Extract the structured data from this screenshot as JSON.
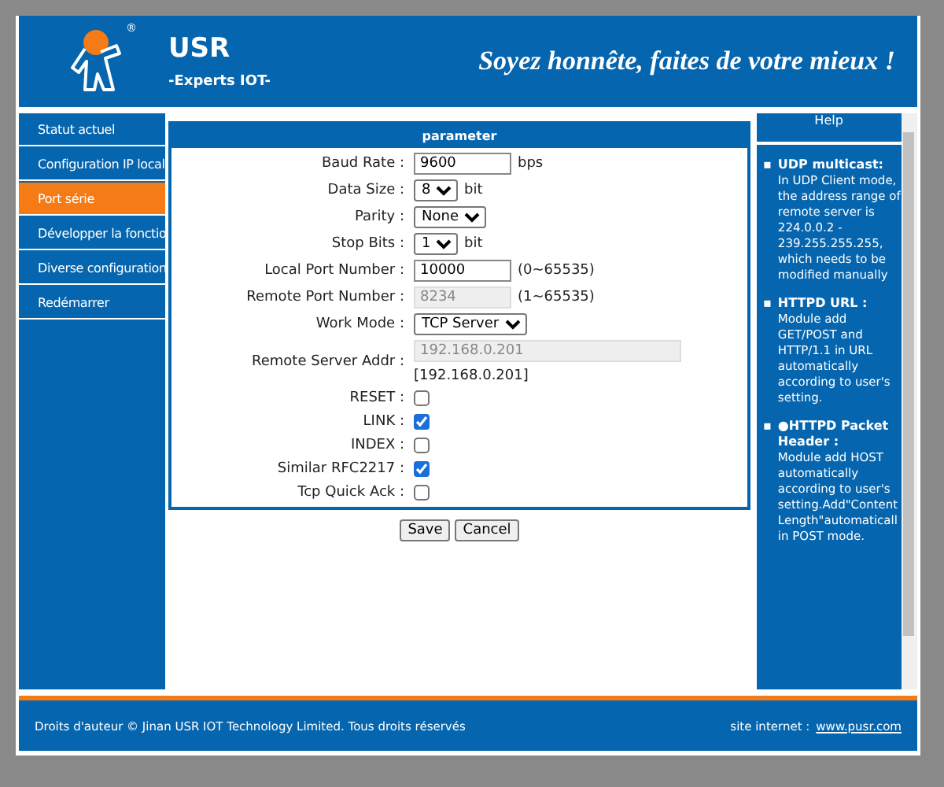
{
  "header": {
    "brand": "USR",
    "registered": "®",
    "tagline": "-Experts IOT-",
    "motto": "Soyez honnête, faites de votre mieux !"
  },
  "sidebar": {
    "items": [
      {
        "label": "Statut actuel",
        "selected": false
      },
      {
        "label": "Configuration IP local",
        "selected": false
      },
      {
        "label": "Port série",
        "selected": true
      },
      {
        "label": "Développer la fonctio",
        "selected": false
      },
      {
        "label": "Diverse configuration",
        "selected": false
      },
      {
        "label": "Redémarrer",
        "selected": false
      }
    ]
  },
  "panel": {
    "title": "parameter",
    "fields": [
      {
        "kind": "input",
        "label": "Baud Rate :",
        "value": "9600",
        "suffix": "bps",
        "disabled": false
      },
      {
        "kind": "select",
        "label": "Data Size :",
        "value": "8",
        "suffix": "bit"
      },
      {
        "kind": "select",
        "label": "Parity :",
        "value": "None"
      },
      {
        "kind": "select",
        "label": "Stop Bits :",
        "value": "1",
        "suffix": "bit"
      },
      {
        "kind": "input",
        "label": "Local Port Number :",
        "value": "10000",
        "suffix": "(0~65535)",
        "disabled": false
      },
      {
        "kind": "input",
        "label": "Remote Port Number :",
        "value": "8234",
        "suffix": "(1~65535)",
        "disabled": true
      },
      {
        "kind": "select",
        "label": "Work Mode :",
        "value": "TCP Server"
      },
      {
        "kind": "wide",
        "label": "Remote Server Addr :",
        "value": "192.168.0.201",
        "note": "[192.168.0.201]",
        "disabled": true
      },
      {
        "kind": "checkbox",
        "label": "RESET :",
        "checked": false
      },
      {
        "kind": "checkbox",
        "label": "LINK :",
        "checked": true
      },
      {
        "kind": "checkbox",
        "label": "INDEX :",
        "checked": false
      },
      {
        "kind": "checkbox",
        "label": "Similar RFC2217 :",
        "checked": true
      },
      {
        "kind": "checkbox",
        "label": "Tcp Quick Ack :",
        "checked": false
      }
    ]
  },
  "buttons": [
    "Save",
    "Cancel"
  ],
  "help": {
    "title": "Help",
    "items": [
      {
        "marker": "▪",
        "title": "UDP multicast:",
        "body": "In UDP Client mode, the address range of remote server is 224.0.0.2 - 239.255.255.255, which needs to be modified manually"
      },
      {
        "marker": "▪",
        "title": "HTTPD URL :",
        "body": "Module add GET/POST and HTTP/1.1 in URL automatically according to user's setting."
      },
      {
        "marker": "▪",
        "title": "●HTTPD Packet Header :",
        "body": "Module add HOST automatically according to user's setting.Add\"Content Length\"automaticall in POST mode."
      }
    ]
  },
  "footer": {
    "copyright": "Droits d'auteur © Jinan USR IOT Technology Limited. Tous droits réservés",
    "site_label": "site internet :",
    "site_link": "www.pusr.com"
  }
}
